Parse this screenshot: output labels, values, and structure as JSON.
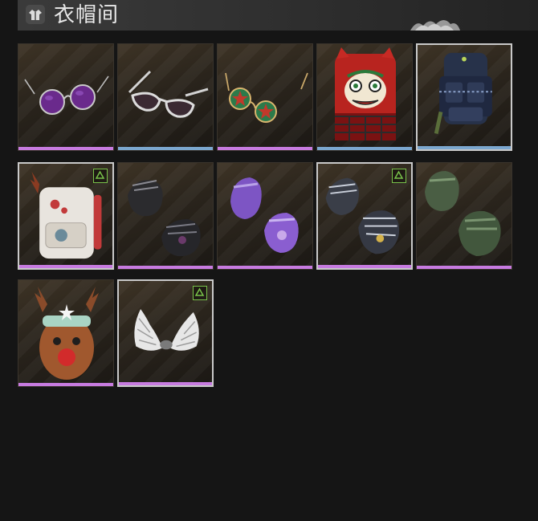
{
  "header": {
    "title": "衣帽间",
    "icon": "wardrobe-icon"
  },
  "colors": {
    "rarity_purple": "#c77be0",
    "rarity_blue": "#7ba7cf",
    "badge_green": "#79c24a",
    "selected_border": "#c9c9c9"
  },
  "items": [
    {
      "name": "purple-round-sunglasses",
      "rarity": "purple",
      "badge": false,
      "selected": false
    },
    {
      "name": "white-aviator-sunglasses",
      "rarity": "blue",
      "badge": false,
      "selected": false
    },
    {
      "name": "star-lens-glasses",
      "rarity": "purple",
      "badge": false,
      "selected": false
    },
    {
      "name": "lion-dance-backpack",
      "rarity": "blue",
      "badge": false,
      "selected": false
    },
    {
      "name": "tactical-backpack",
      "rarity": "blue",
      "badge": false,
      "selected": true
    },
    {
      "name": "reindeer-backpack",
      "rarity": "purple",
      "badge": true,
      "selected": true
    },
    {
      "name": "black-studded-gloves",
      "rarity": "purple",
      "badge": false,
      "selected": false
    },
    {
      "name": "purple-gloves",
      "rarity": "purple",
      "badge": false,
      "selected": false
    },
    {
      "name": "cyber-claw-gloves",
      "rarity": "purple",
      "badge": true,
      "selected": true
    },
    {
      "name": "green-camo-gloves",
      "rarity": "purple",
      "badge": false,
      "selected": false
    },
    {
      "name": "reindeer-hat",
      "rarity": "purple",
      "badge": false,
      "selected": false
    },
    {
      "name": "white-feather-wings",
      "rarity": "purple",
      "badge": true,
      "selected": true
    }
  ]
}
